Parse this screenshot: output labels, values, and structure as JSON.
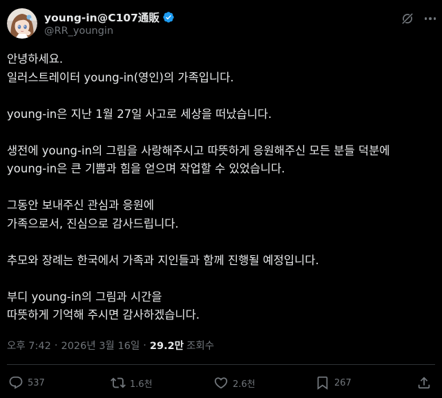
{
  "author": {
    "display_name": "young-in@C107通販",
    "handle": "@RR_youngin",
    "avatar_icon": "avatar-image",
    "verified_icon": "verified-badge-icon"
  },
  "post": {
    "lines": [
      "안녕하세요.",
      "일러스트레이터 young-in(영인)의 가족입니다.",
      "",
      "young-in은 지난 1월 27일 사고로 세상을 떠났습니다.",
      "",
      "생전에 young-in의 그림을 사랑해주시고 따뜻하게 응원해주신 모든 분들 덕분에",
      "young-in은 큰 기쁨과 힘을 얻으며 작업할 수 있었습니다.",
      "",
      "그동안 보내주신 관심과 응원에",
      "가족으로서, 진심으로 감사드립니다.",
      "",
      "추모와 장례는 한국에서 가족과 지인들과 함께 진행될 예정입니다.",
      "",
      "부디 young-in의 그림과 시간을",
      "따뜻하게 기억해 주시면 감사하겠습니다."
    ]
  },
  "meta": {
    "time": "오후 7:42",
    "separator": "·",
    "date": "2026년 3월 16일",
    "views_count": "29.2만",
    "views_label": "조회수"
  },
  "actions": {
    "reply": {
      "icon": "reply-icon",
      "count": "537"
    },
    "repost": {
      "icon": "repost-icon",
      "count": "1.6천"
    },
    "like": {
      "icon": "heart-icon",
      "count": "2.6천"
    },
    "bookmark": {
      "icon": "bookmark-icon",
      "count": "267"
    },
    "share": {
      "icon": "share-icon"
    }
  },
  "colors": {
    "background": "#000000",
    "text_primary": "#e7e9ea",
    "text_secondary": "#71767b",
    "verified": "#1d9bf0",
    "divider": "#2f3336"
  }
}
